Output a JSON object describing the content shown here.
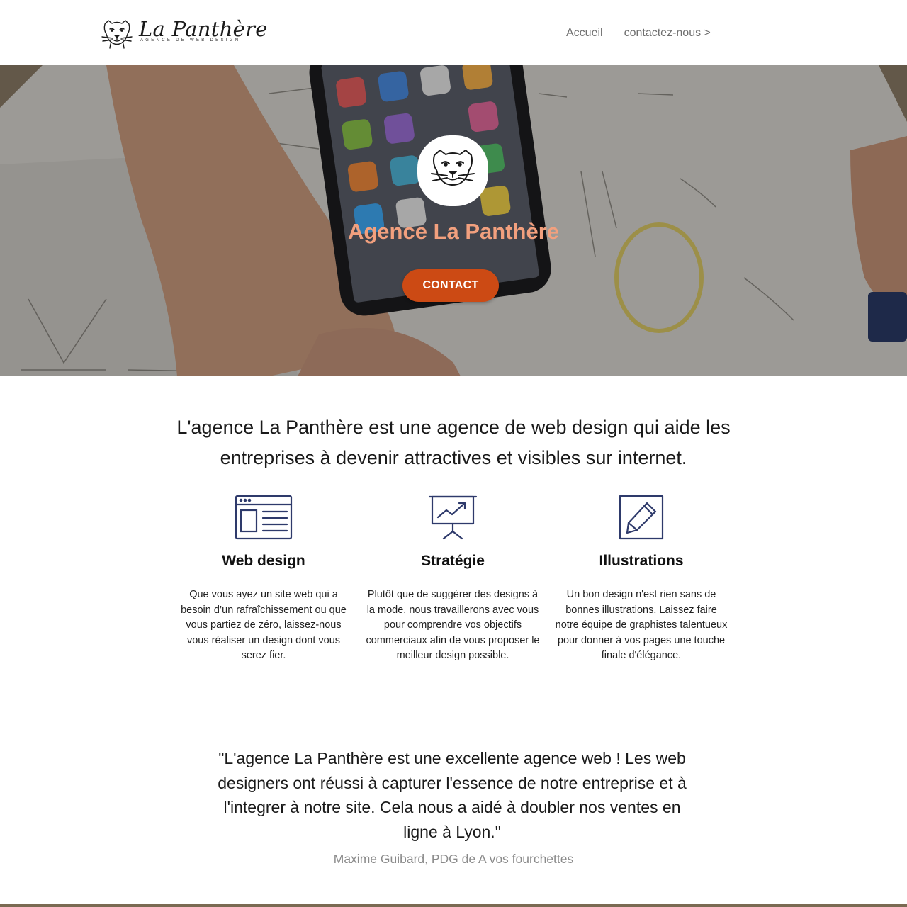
{
  "header": {
    "brand_name": "La Panthère",
    "brand_tagline": "AGENCE DE WEB DESIGN",
    "nav": [
      {
        "label": "Accueil"
      },
      {
        "label": "contactez-nous >"
      }
    ]
  },
  "hero": {
    "title": "Agence La Panthère",
    "cta_label": "CONTACT",
    "logo_icon": "panther-head-icon"
  },
  "intro": {
    "text": "L'agence La Panthère est une agence de web design qui aide les entreprises à devenir attractives et visibles sur internet."
  },
  "features": [
    {
      "icon": "browser-window-icon",
      "title": "Web design",
      "text": "Que vous ayez un site web qui a besoin d’un rafraîchissement ou que vous partiez de zéro, laissez-nous vous réaliser un design dont vous serez fier."
    },
    {
      "icon": "presentation-chart-icon",
      "title": "Stratégie",
      "text": "Plutôt que de suggérer des designs à la mode, nous travaillerons avec vous pour comprendre vos objectifs commerciaux afin de vous proposer le meilleur design possible."
    },
    {
      "icon": "pencil-square-icon",
      "title": "Illustrations",
      "text": "Un bon design n'est rien sans de bonnes illustrations. Laissez faire notre équipe de graphistes talentueux pour donner à vos pages une touche finale d'élégance."
    }
  ],
  "testimonial": {
    "quote": "\"L'agence La Panthère est une excellente agence web ! Les web designers ont réussi à capturer l'essence de notre entreprise et à l'integrer à notre site. Cela nous a aidé à doubler nos ventes en ligne à Lyon.\"",
    "author": "Maxime Guibard, PDG de A vos fourchettes"
  },
  "colors": {
    "accent": "#cc4a14",
    "hero_title": "#f2a07e",
    "icon_stroke": "#2e3a6b"
  }
}
